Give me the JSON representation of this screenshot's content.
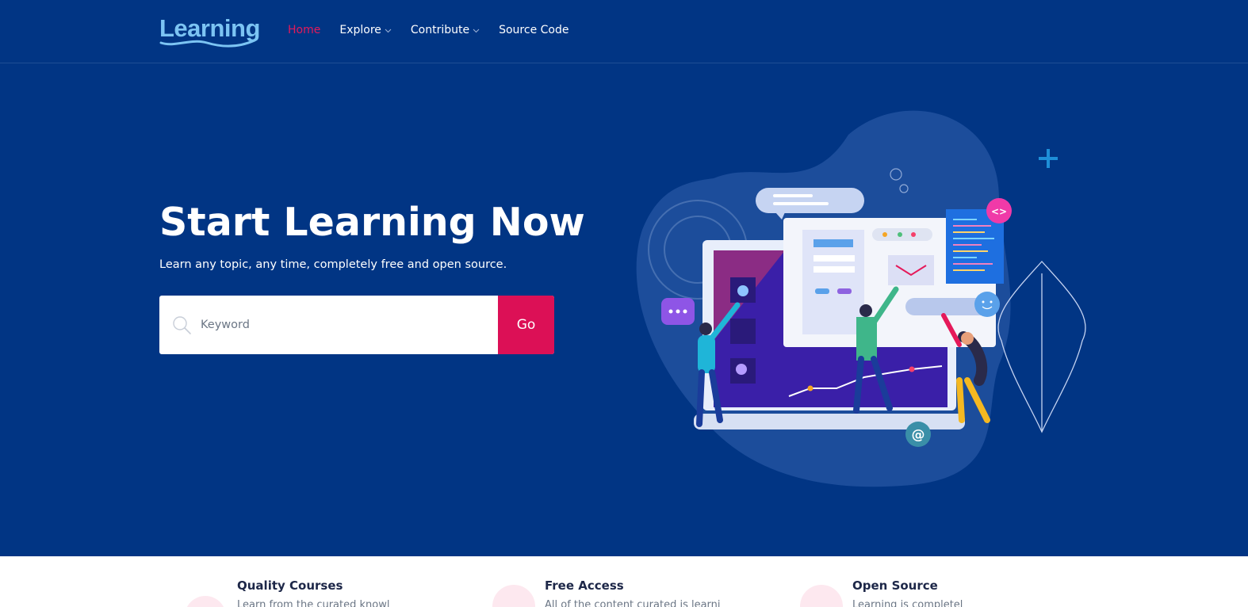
{
  "brand": {
    "logo_text": "Learning"
  },
  "nav": {
    "items": [
      {
        "label": "Home",
        "active": true,
        "dropdown": false
      },
      {
        "label": "Explore",
        "active": false,
        "dropdown": true
      },
      {
        "label": "Contribute",
        "active": false,
        "dropdown": true
      },
      {
        "label": "Source Code",
        "active": false,
        "dropdown": false
      }
    ]
  },
  "hero": {
    "title": "Start Learning Now",
    "subtitle": "Learn any topic, any time, completely free and open source.",
    "search": {
      "placeholder": "Keyword",
      "value": ""
    },
    "go_label": "Go"
  },
  "features": [
    {
      "title": "Quality Courses",
      "text": "Learn from the curated knowl",
      "icon": "star-icon"
    },
    {
      "title": "Free Access",
      "text": "All of the content curated is learni",
      "icon": "infinity-icon"
    },
    {
      "title": "Open Source",
      "text": "Learning is completel",
      "icon": "code-icon"
    }
  ],
  "colors": {
    "background": "#013584",
    "accent": "#dc1056",
    "active_nav": "#e5195a",
    "logo": "#7cc4f3"
  }
}
